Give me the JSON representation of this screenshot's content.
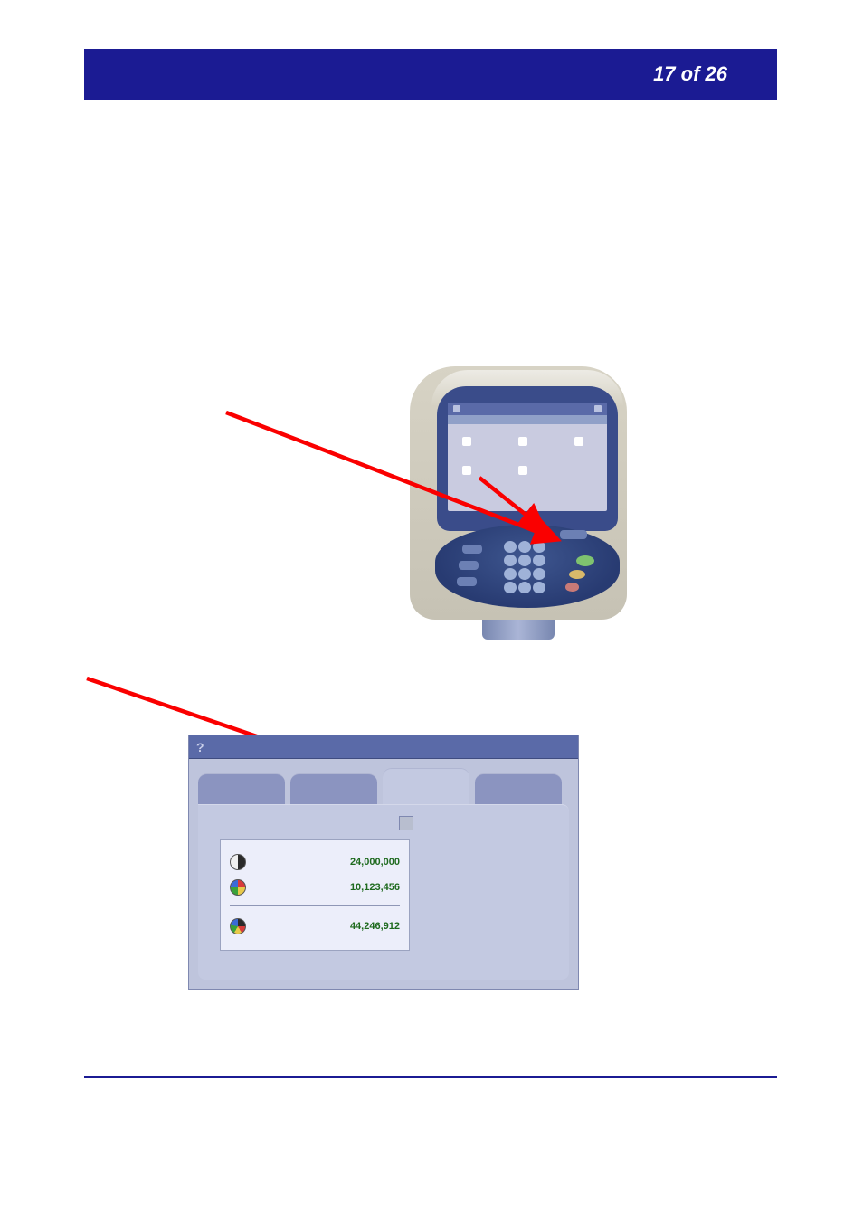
{
  "header": {
    "page_indicator": "17 of 26"
  },
  "counters": {
    "bw": "24,000,000",
    "color": "10,123,456",
    "total": "44,246,912"
  }
}
